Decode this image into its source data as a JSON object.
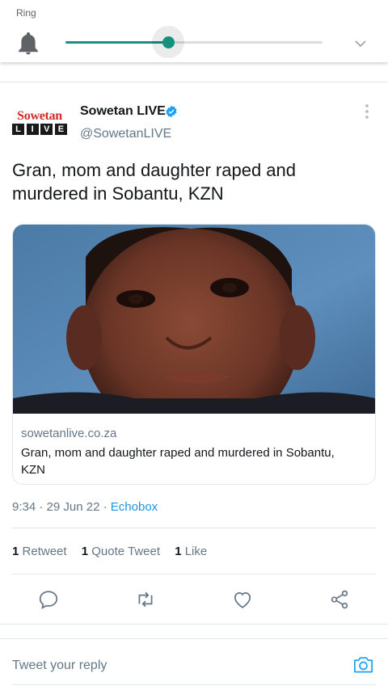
{
  "volume_panel": {
    "label": "Ring",
    "level": 0.4,
    "accent_color": "#16917e",
    "icons": {
      "ring": "bell-icon",
      "expand": "chevron-down-icon"
    }
  },
  "tweet": {
    "display_name": "Sowetan LIVE",
    "verified": true,
    "handle": "@SowetanLIVE",
    "avatar_logo": {
      "top": "Sowetan",
      "bottom_letters": [
        "L",
        "I",
        "V",
        "E"
      ]
    },
    "text": "Gran, mom and daughter raped and murdered in Sobantu, KZN",
    "card": {
      "domain": "sowetanlive.co.za",
      "title": "Gran, mom and daughter raped and murdered in Sobantu, KZN"
    },
    "time": "9:34",
    "separator": "·",
    "date": "29 Jun 22",
    "source": "Echobox",
    "stats": {
      "retweets": {
        "count": "1",
        "label": "Retweet"
      },
      "quote_tweets": {
        "count": "1",
        "label": "Quote Tweet"
      },
      "likes": {
        "count": "1",
        "label": "Like"
      }
    },
    "actions": [
      "reply-icon",
      "retweet-icon",
      "like-icon",
      "share-icon"
    ]
  },
  "reply_bar": {
    "placeholder": "Tweet your reply",
    "icon": "camera-icon"
  },
  "colors": {
    "link": "#1b95e0",
    "secondary_text": "#657786",
    "logo_red": "#d42a25"
  }
}
